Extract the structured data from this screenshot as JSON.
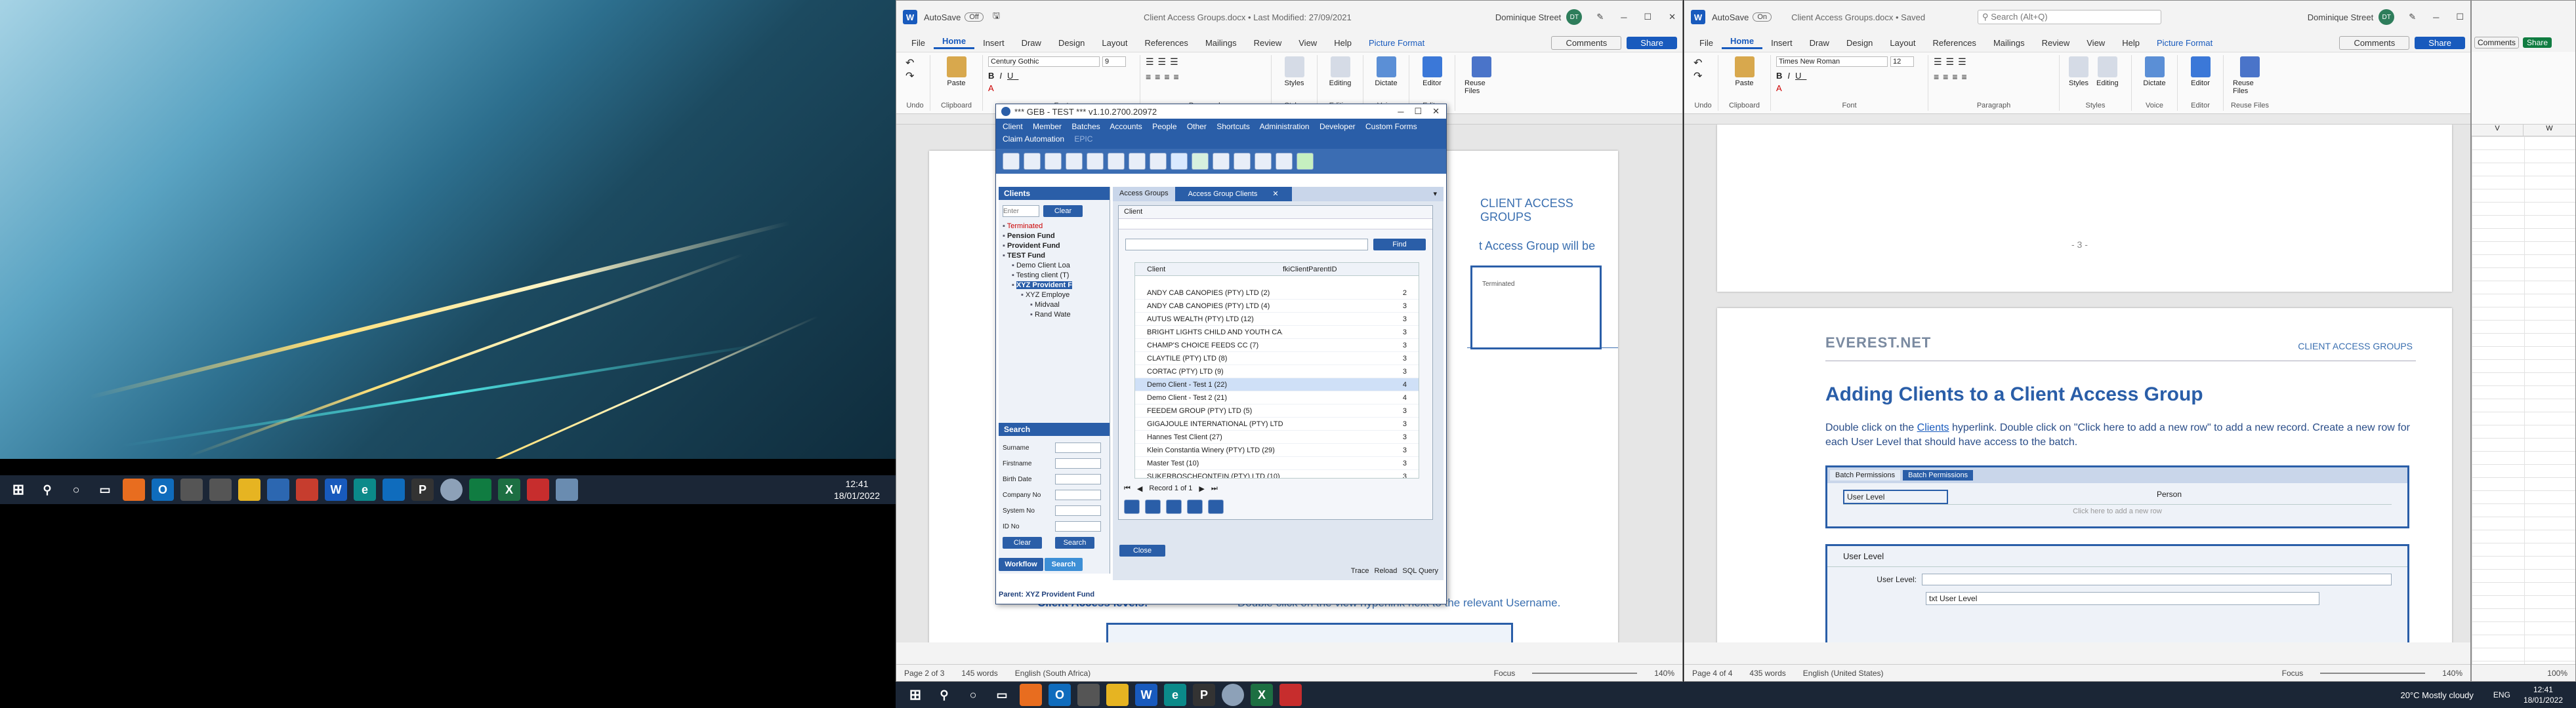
{
  "desktop": {
    "clock": {
      "time": "12:41",
      "date": "18/01/2022"
    }
  },
  "word_left": {
    "autosave": "AutoSave",
    "autosave_state": "Off",
    "title": "Client Access Groups.docx • Last Modified: 27/09/2021",
    "user": "Dominique Street",
    "user_initials": "DT",
    "tabs": [
      "File",
      "Home",
      "Insert",
      "Draw",
      "Design",
      "Layout",
      "References",
      "Mailings",
      "Review",
      "View",
      "Help",
      "Picture Format"
    ],
    "comments": "Comments",
    "share": "Share",
    "font": "Century Gothic",
    "font_size": "9",
    "groups": [
      "Undo",
      "Clipboard",
      "Font",
      "Paragraph",
      "Styles",
      "Editing",
      "Voice",
      "Editor",
      "Reuse Files"
    ],
    "buttons": {
      "paste": "Paste",
      "styles": "Styles",
      "editing": "Editing",
      "dictate": "Dictate",
      "editor": "Editor",
      "reuse": "Reuse Files"
    },
    "doc": {
      "heading": "CLIENT ACCESS GROUPS",
      "text1": "t Access Group will be",
      "table_cell": "Terminated",
      "levels_label": "Client Access levels:",
      "levels_text": "Double click on the view hyperlink next to the relevant Username."
    },
    "status": {
      "page": "Page 2 of 3",
      "words": "145 words",
      "lang": "English (South Africa)",
      "focus": "Focus",
      "zoom": "140%"
    }
  },
  "geb": {
    "title": "*** GEB - TEST *** v1.10.2700.20972",
    "menu_row1": [
      "Client",
      "Member",
      "Batches",
      "Accounts",
      "People",
      "Other",
      "Shortcuts",
      "Administration",
      "Developer",
      "Custom Forms"
    ],
    "menu_row2": [
      "Claim Automation",
      "EPIC"
    ],
    "clients_panel": {
      "title": "Clients",
      "filter_placeholder": "Enter",
      "clear": "Clear",
      "tree": [
        {
          "label": "Terminated",
          "indent": 0,
          "style": "red"
        },
        {
          "label": "Pension Fund",
          "indent": 0,
          "style": "bold"
        },
        {
          "label": "Provident Fund",
          "indent": 0,
          "style": "bold"
        },
        {
          "label": "TEST Fund",
          "indent": 0,
          "style": "bold"
        },
        {
          "label": "Demo Client Loa",
          "indent": 1,
          "style": "normal"
        },
        {
          "label": "Testing client (T)",
          "indent": 1,
          "style": "normal"
        },
        {
          "label": "XYZ Provident F",
          "indent": 1,
          "style": "selected"
        },
        {
          "label": "XYZ Employe",
          "indent": 2,
          "style": "normal"
        },
        {
          "label": "Midvaal",
          "indent": 3,
          "style": "normal"
        },
        {
          "label": "Rand Wate",
          "indent": 3,
          "style": "normal"
        }
      ]
    },
    "search_panel": {
      "title": "Search",
      "fields": [
        "Surname",
        "Firstname",
        "Birth Date",
        "Company No",
        "System No",
        "ID No"
      ],
      "clear": "Clear",
      "search": "Search"
    },
    "bottom_tabs": [
      "Workflow",
      "Search"
    ],
    "parent_label": "Parent: XYZ Provident Fund",
    "footer_links": [
      "Trace",
      "Reload",
      "SQL Query"
    ],
    "tabs": [
      "Access Groups",
      "Access Group Clients"
    ],
    "client_combo_label": "Client",
    "find": "Find",
    "grid": {
      "headers": [
        "Client",
        "fkiClientParentID"
      ],
      "rows": [
        {
          "client": "ANDY CAB CANOPIES (PTY) LTD (2)",
          "parent": "2"
        },
        {
          "client": "ANDY CAB CANOPIES (PTY) LTD (4)",
          "parent": "3"
        },
        {
          "client": "AUTUS WEALTH (PTY) LTD (12)",
          "parent": "3"
        },
        {
          "client": "BRIGHT LIGHTS CHILD AND YOUTH CA...",
          "parent": "3"
        },
        {
          "client": "CHAMP'S CHOICE FEEDS CC (7)",
          "parent": "3"
        },
        {
          "client": "CLAYTILE (PTY) LTD (8)",
          "parent": "3"
        },
        {
          "client": "CORTAC (PTY) LTD (9)",
          "parent": "3"
        },
        {
          "client": "Demo Client - Test 1 (22)",
          "parent": "4"
        },
        {
          "client": "Demo Client - Test 2 (21)",
          "parent": "4"
        },
        {
          "client": "FEEDEM GROUP (PTY) LTD (5)",
          "parent": "3"
        },
        {
          "client": "GIGAJOULE INTERNATIONAL (PTY) LTD ...",
          "parent": "3"
        },
        {
          "client": "Hannes Test Client (27)",
          "parent": "3"
        },
        {
          "client": "Klein Constantia Winery (PTY) LTD (29)",
          "parent": "3"
        },
        {
          "client": "Master Test (10)",
          "parent": "3"
        },
        {
          "client": "SUKERBOSCHFONTEIN (PTY) LTD (10)",
          "parent": "3"
        }
      ],
      "selected_index": 7
    },
    "record_nav": "Record 1 of 1",
    "close": "Close"
  },
  "word_right": {
    "autosave": "AutoSave",
    "autosave_state": "On",
    "title": "Client Access Groups.docx • Saved",
    "search_placeholder": "Search (Alt+Q)",
    "user": "Dominique Street",
    "user_initials": "DT",
    "tabs": [
      "File",
      "Home",
      "Insert",
      "Draw",
      "Design",
      "Layout",
      "References",
      "Mailings",
      "Review",
      "View",
      "Help",
      "Picture Format"
    ],
    "comments": "Comments",
    "share": "Share",
    "font": "Times New Roman",
    "font_size": "12",
    "groups": [
      "Undo",
      "Clipboard",
      "Font",
      "Paragraph",
      "Styles",
      "Voice",
      "Editor",
      "Reuse Files"
    ],
    "buttons": {
      "paste": "Paste",
      "styles": "Styles",
      "editing": "Editing",
      "dictate": "Dictate",
      "editor": "Editor",
      "reuse": "Reuse Files"
    },
    "doc": {
      "page_num": "- 3 -",
      "logo": "EVEREST.NET",
      "header_right": "CLIENT ACCESS GROUPS",
      "heading": "Adding Clients to a Client Access Group",
      "para_a": "Double click on the ",
      "para_link": "Clients",
      "para_b": " hyperlink. Double click on \"Click here to add a new row\" to add a new record. Create a new row for each User Level that should have access to the batch.",
      "screenshot_tabs": [
        "Batch Permissions",
        "Batch Permissions"
      ],
      "col_user_level": "User Level",
      "col_person": "Person",
      "add_row": "Click here to add a new row",
      "form_title": "User Level",
      "form_label": "User Level:",
      "dropdown_item": "txt User Level"
    },
    "status": {
      "page": "Page 4 of 4",
      "words": "435 words",
      "lang": "English (United States)",
      "focus": "Focus",
      "zoom": "140%"
    }
  },
  "excel": {
    "share": "Share",
    "comments": "Comments",
    "col_v": "V",
    "col_w": "W",
    "zoom": "100%"
  },
  "taskbar_right": {
    "weather": "20°C  Mostly cloudy",
    "lang": "ENG",
    "time": "12:41",
    "date": "18/01/2022"
  }
}
